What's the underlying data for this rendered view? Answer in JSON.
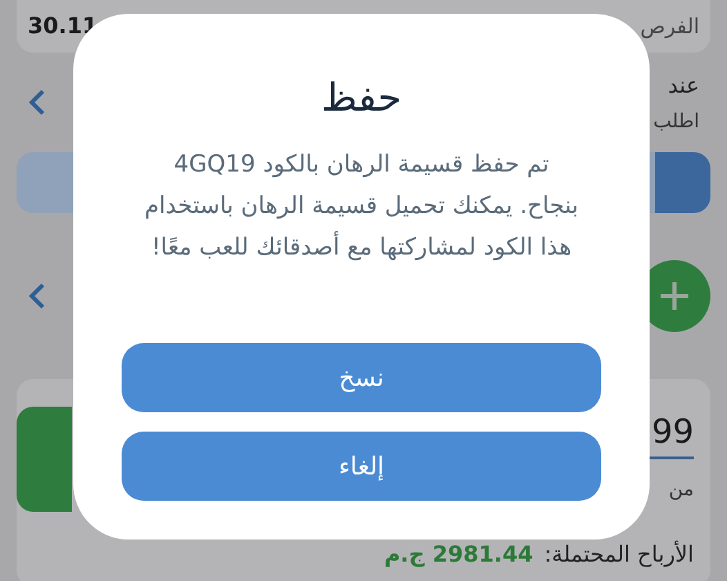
{
  "background": {
    "balance": "30.11",
    "balance_label": "الفرص",
    "notice": "عند",
    "request": "اطلب",
    "odds": "99",
    "from": "من",
    "potential_label": "الأرباح المحتملة:",
    "potential_value": "2981.44 ج.م"
  },
  "dialog": {
    "title": "حفظ",
    "message": "تم حفظ قسيمة الرهان بالكود 4GQ19 بنجاح. يمكنك تحميل قسيمة الرهان باستخدام هذا الكود لمشاركتها مع أصدقائك للعب معًا!",
    "buttons": [
      "نسخ",
      "إلغاء"
    ]
  }
}
